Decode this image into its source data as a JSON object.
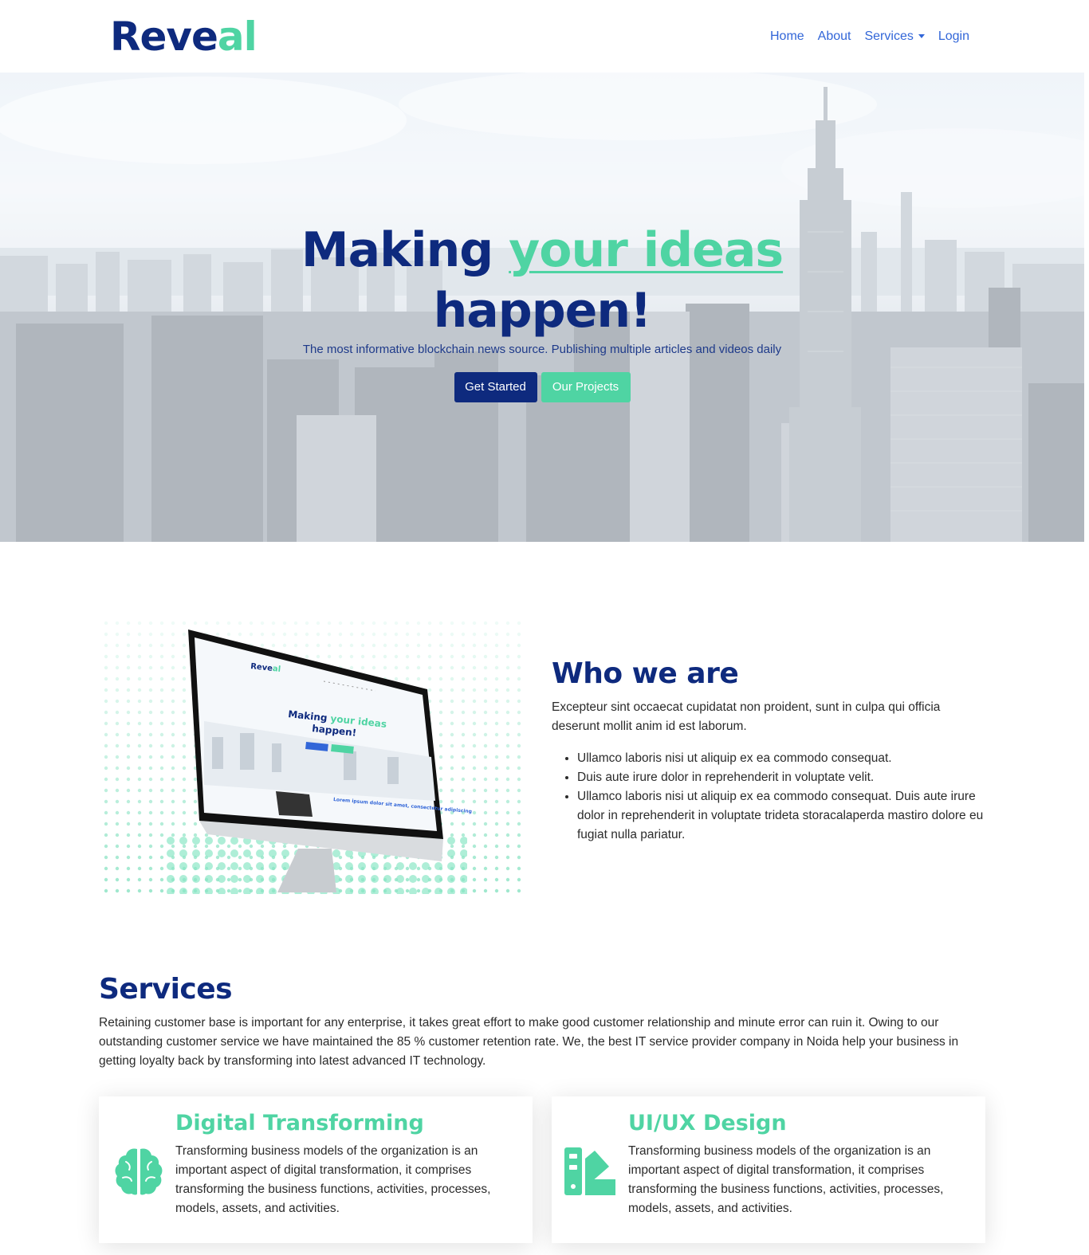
{
  "brand": {
    "part1": "Reve",
    "part2": "al"
  },
  "nav": {
    "home": "Home",
    "about": "About",
    "services": "Services",
    "login": "Login"
  },
  "hero": {
    "title_part1": "Making ",
    "title_accent": "your ideas",
    "title_part2": "happen!",
    "subtitle": "The most informative blockchain news source. Publishing multiple articles and videos daily",
    "btn_primary": "Get Started",
    "btn_secondary": "Our Projects"
  },
  "about": {
    "title": "Who we are",
    "text": "Excepteur sint occaecat cupidatat non proident, sunt in culpa qui officia deserunt mollit anim id est laborum.",
    "items": [
      "Ullamco laboris nisi ut aliquip ex ea commodo consequat.",
      "Duis aute irure dolor in reprehenderit in voluptate velit.",
      "Ullamco laboris nisi ut aliquip ex ea commodo consequat. Duis aute irure dolor in reprehenderit in voluptate trideta storacalaperda mastiro dolore eu fugiat nulla pariatur."
    ],
    "screen": {
      "brand1": "Reve",
      "brand2": "al",
      "title1": "Making ",
      "title_accent": "your ideas",
      "title2": "happen!",
      "lorem": "Lorem ipsum dolor sit amet, consectetur adipiscing"
    }
  },
  "services": {
    "title": "Services",
    "text": "Retaining customer base is important for any enterprise, it takes great effort to make good customer relationship and minute error can ruin it. Owing to our outstanding customer service we have maintained the 85 % customer retention rate. We, the best IT service provider company in Noida help your business in getting loyalty back by transforming into latest advanced IT technology.",
    "cards": [
      {
        "title": "Digital Transforming",
        "icon": "brain-icon",
        "text": "Transforming business models of the organization is an important aspect of digital transformation, it comprises transforming the business functions, activities, processes, models, assets, and activities."
      },
      {
        "title": "UI/UX Design",
        "icon": "swatchbook-icon",
        "text": "Transforming business models of the organization is an important aspect of digital transformation, it comprises transforming the business functions, activities, processes, models, assets, and activities."
      }
    ]
  },
  "colors": {
    "primary": "#0e2a7e",
    "accent": "#4fd4a3",
    "link": "#3266d8"
  }
}
